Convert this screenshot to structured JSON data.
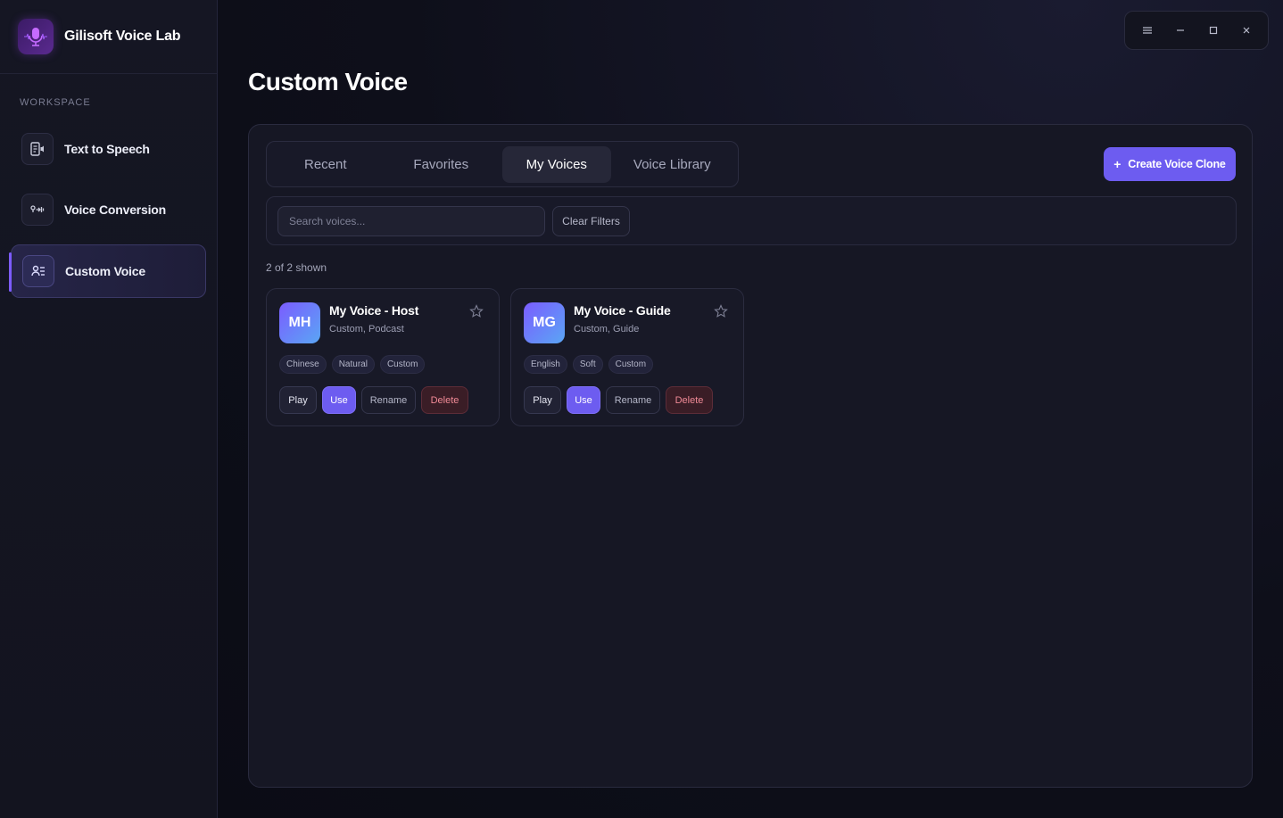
{
  "app": {
    "name": "Gilisoft Voice Lab",
    "logo_icon": "microphone-waveform-icon"
  },
  "sidebar": {
    "section_label": "WORKSPACE",
    "items": [
      {
        "label": "Text to Speech",
        "icon": "text-to-speech-icon",
        "active": false
      },
      {
        "label": "Voice Conversion",
        "icon": "voice-conversion-icon",
        "active": false
      },
      {
        "label": "Custom Voice",
        "icon": "custom-voice-icon",
        "active": true
      }
    ]
  },
  "window_controls": {
    "menu_icon": "menu-icon",
    "minimize_icon": "minimize-icon",
    "maximize_icon": "maximize-icon",
    "close_icon": "close-icon"
  },
  "page": {
    "title": "Custom Voice"
  },
  "tabs": [
    {
      "label": "Recent",
      "active": false
    },
    {
      "label": "Favorites",
      "active": false
    },
    {
      "label": "My Voices",
      "active": true
    },
    {
      "label": "Voice Library",
      "active": false
    }
  ],
  "create_button": {
    "icon": "+",
    "label": "Create Voice Clone"
  },
  "filters": {
    "search_placeholder": "Search voices...",
    "search_value": "",
    "clear_label": "Clear Filters"
  },
  "results": {
    "count_text": "2 of 2 shown"
  },
  "voices": [
    {
      "initials": "MH",
      "name": "My Voice - Host",
      "subtitle": "Custom, Podcast",
      "favorite": false,
      "tags": [
        "Chinese",
        "Natural",
        "Custom"
      ],
      "actions": {
        "play": "Play",
        "use": "Use",
        "rename": "Rename",
        "delete": "Delete"
      }
    },
    {
      "initials": "MG",
      "name": "My Voice - Guide",
      "subtitle": "Custom, Guide",
      "favorite": false,
      "tags": [
        "English",
        "Soft",
        "Custom"
      ],
      "actions": {
        "play": "Play",
        "use": "Use",
        "rename": "Rename",
        "delete": "Delete"
      }
    }
  ],
  "colors": {
    "accent": "#6d5cf0",
    "background": "#0c0d16",
    "panel": "#161724",
    "danger": "#f08a96"
  }
}
